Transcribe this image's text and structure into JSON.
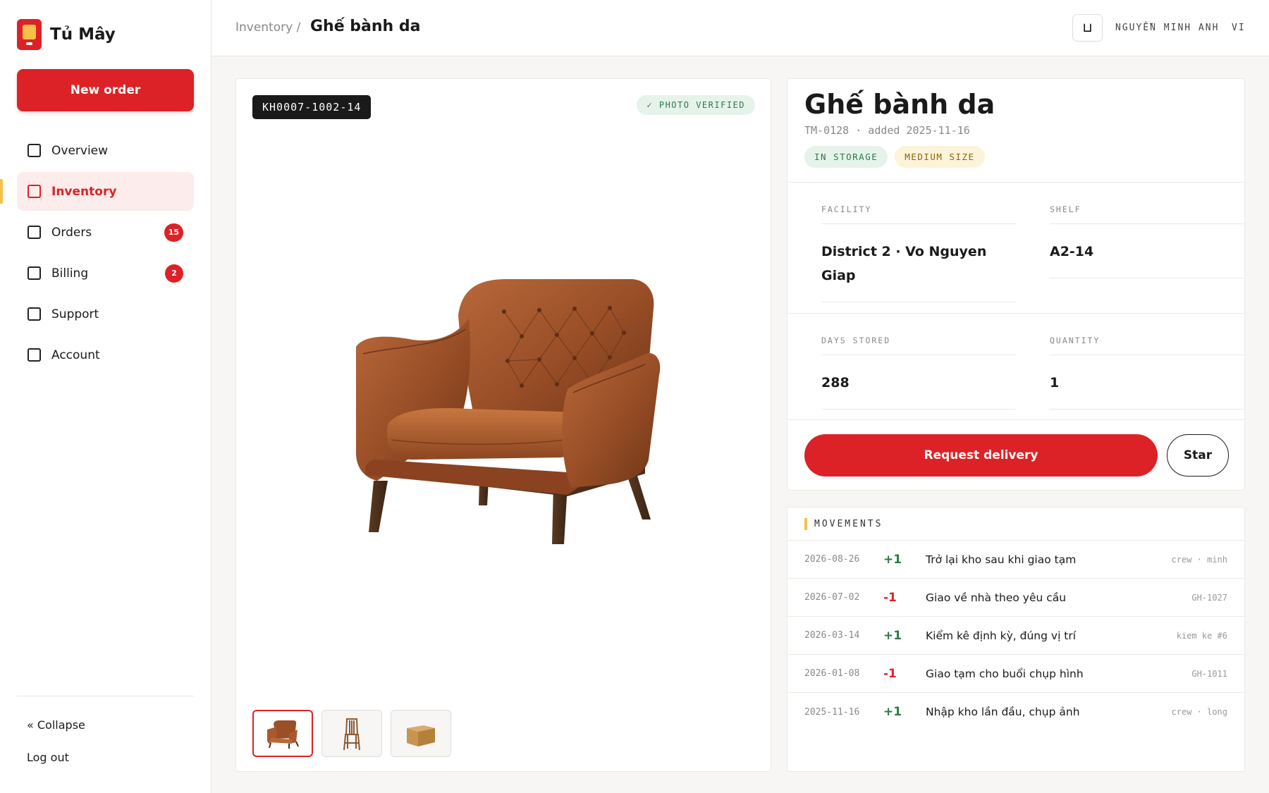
{
  "app": {
    "name": "Tủ Mây",
    "new_order_label": "New order"
  },
  "sidebar": {
    "items": [
      {
        "label": "Overview",
        "badge": null,
        "active": false
      },
      {
        "label": "Inventory",
        "badge": null,
        "active": true
      },
      {
        "label": "Orders",
        "badge": "15",
        "active": false
      },
      {
        "label": "Billing",
        "badge": "2",
        "active": false
      },
      {
        "label": "Support",
        "badge": null,
        "active": false
      },
      {
        "label": "Account",
        "badge": null,
        "active": false
      }
    ],
    "collapse_label": "« Collapse",
    "logout_label": "Log out"
  },
  "topbar": {
    "breadcrumb_parent": "Inventory /",
    "breadcrumb_current": "Ghế bành da",
    "icon_glyph": "⊔",
    "user_name": "NGUYỄN MINH ANH",
    "language": "VI"
  },
  "photo": {
    "sku": "KH0007-1002-14",
    "verified_label": "✓ PHOTO VERIFIED",
    "thumbnails": [
      {
        "name": "armchair-thumbnail",
        "active": true
      },
      {
        "name": "wooden-chair-thumbnail",
        "active": false
      },
      {
        "name": "cardboard-box-thumbnail",
        "active": false
      }
    ]
  },
  "item": {
    "title": "Ghế bành da",
    "meta": "TM-0128 · added 2025-11-16",
    "tags": [
      {
        "label": "IN STORAGE",
        "tone": "green"
      },
      {
        "label": "MEDIUM SIZE",
        "tone": "yellow"
      }
    ],
    "fields": {
      "facility_label": "FACILITY",
      "facility_value": "District 2 · Vo Nguyen Giap",
      "shelf_label": "SHELF",
      "shelf_value": "A2-14",
      "days_label": "DAYS STORED",
      "days_value": "288",
      "quantity_label": "QUANTITY",
      "quantity_value": "1"
    },
    "request_label": "Request delivery",
    "star_label": "Star"
  },
  "movements": {
    "title": "MOVEMENTS",
    "rows": [
      {
        "date": "2026-08-26",
        "delta": "+1",
        "desc": "Trở lại kho sau khi giao tạm",
        "ref": "crew · minh"
      },
      {
        "date": "2026-07-02",
        "delta": "-1",
        "desc": "Giao về nhà theo yêu cầu",
        "ref": "GH-1027"
      },
      {
        "date": "2026-03-14",
        "delta": "+1",
        "desc": "Kiểm kê định kỳ, đúng vị trí",
        "ref": "kiem ke #6"
      },
      {
        "date": "2026-01-08",
        "delta": "-1",
        "desc": "Giao tạm cho buổi chụp hình",
        "ref": "GH-1011"
      },
      {
        "date": "2025-11-16",
        "delta": "+1",
        "desc": "Nhập kho lần đầu, chụp ảnh",
        "ref": "crew · long"
      }
    ]
  },
  "colors": {
    "brand_red": "#dc2226",
    "accent_yellow": "#f5c14a",
    "positive_green": "#2c7a45"
  }
}
